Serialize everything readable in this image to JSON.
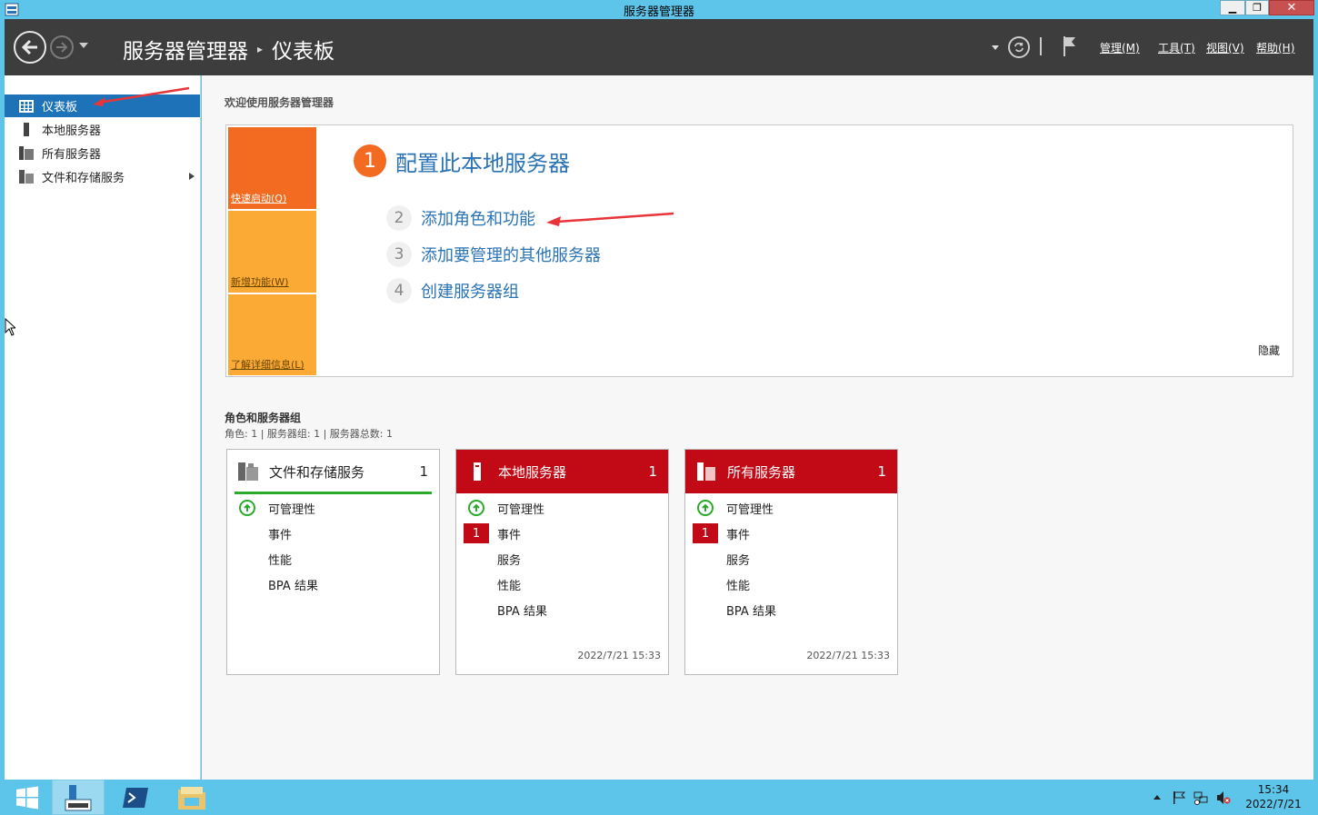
{
  "window": {
    "title": "服务器管理器"
  },
  "header": {
    "breadcrumb_root": "服务器管理器",
    "breadcrumb_sep": "▸",
    "breadcrumb_current": "仪表板",
    "menus": [
      "管理(M)",
      "工具(T)",
      "视图(V)",
      "帮助(H)"
    ]
  },
  "sidebar": {
    "items": [
      {
        "label": "仪表板",
        "icon": "dashboard-icon",
        "active": true
      },
      {
        "label": "本地服务器",
        "icon": "local-server-icon"
      },
      {
        "label": "所有服务器",
        "icon": "all-servers-icon"
      },
      {
        "label": "文件和存储服务",
        "icon": "file-storage-icon",
        "expandable": true
      }
    ]
  },
  "welcome": {
    "title": "欢迎使用服务器管理器",
    "tiles": [
      "快速启动(Q)",
      "新增功能(W)",
      "了解详细信息(L)"
    ],
    "main_step_num": "1",
    "main_step": "配置此本地服务器",
    "steps": [
      {
        "num": "2",
        "label": "添加角色和功能"
      },
      {
        "num": "3",
        "label": "添加要管理的其他服务器"
      },
      {
        "num": "4",
        "label": "创建服务器组"
      }
    ],
    "hide": "隐藏"
  },
  "roles": {
    "title": "角色和服务器组",
    "summary": "角色: 1 | 服务器组: 1 | 服务器总数: 1",
    "cards": [
      {
        "name": "文件和存储服务",
        "count": "1",
        "status": "ok",
        "rows": [
          "可管理性",
          "事件",
          "性能",
          "BPA 结果"
        ],
        "timestamp": ""
      },
      {
        "name": "本地服务器",
        "count": "1",
        "status": "error",
        "rows": [
          "可管理性",
          "事件",
          "服务",
          "性能",
          "BPA 结果"
        ],
        "event_badge": "1",
        "timestamp": "2022/7/21 15:33"
      },
      {
        "name": "所有服务器",
        "count": "1",
        "status": "error",
        "rows": [
          "可管理性",
          "事件",
          "服务",
          "性能",
          "BPA 结果"
        ],
        "event_badge": "1",
        "timestamp": "2022/7/21 15:33"
      }
    ]
  },
  "taskbar": {
    "time": "15:34",
    "date": "2022/7/21"
  },
  "colors": {
    "accent": "#1e73b8",
    "orange": "#f26b21",
    "amber": "#fbaa36",
    "error_red": "#c20a16",
    "ok_green": "#2bab2b",
    "link_blue": "#2a73b5"
  }
}
